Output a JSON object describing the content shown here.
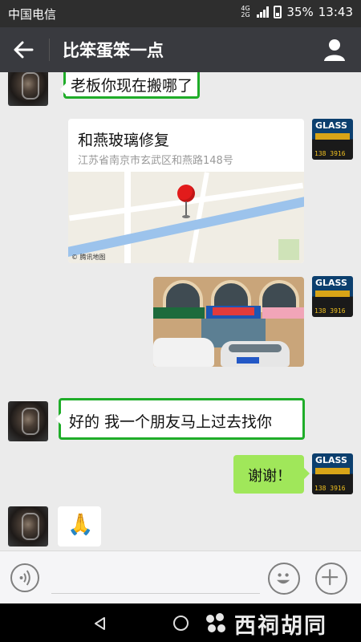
{
  "status_bar": {
    "carrier": "中国电信",
    "network_badge": "4G 2G",
    "battery": "35%",
    "time": "13:43"
  },
  "header": {
    "title": "比笨蛋笨一点",
    "back_icon": "arrow-left-icon",
    "profile_icon": "person-icon"
  },
  "messages": {
    "m1": {
      "text": "老板你现在搬哪了"
    },
    "m2": {
      "name": "和燕玻璃修复",
      "address": "江苏省南京市玄武区和燕路148号",
      "map_credit": "© 腾讯地图"
    },
    "m4": {
      "text": "好的  我一个朋友马上过去找你"
    },
    "m5": {
      "text": "谢谢！"
    },
    "m6": {
      "sticker": "🙏"
    }
  },
  "avatars": {
    "right_text": "GLASS",
    "right_number": "138 3916"
  },
  "input_bar": {
    "voice_icon": "voice-icon",
    "emoji_icon": "emoji-icon",
    "plus_icon": "plus-icon"
  },
  "watermark": {
    "text": "西祠胡同"
  },
  "colors": {
    "header_bg": "#393a3f",
    "chat_bg": "#ebebeb",
    "sent_bubble": "#a0e75a",
    "highlight": "#1fad29"
  }
}
